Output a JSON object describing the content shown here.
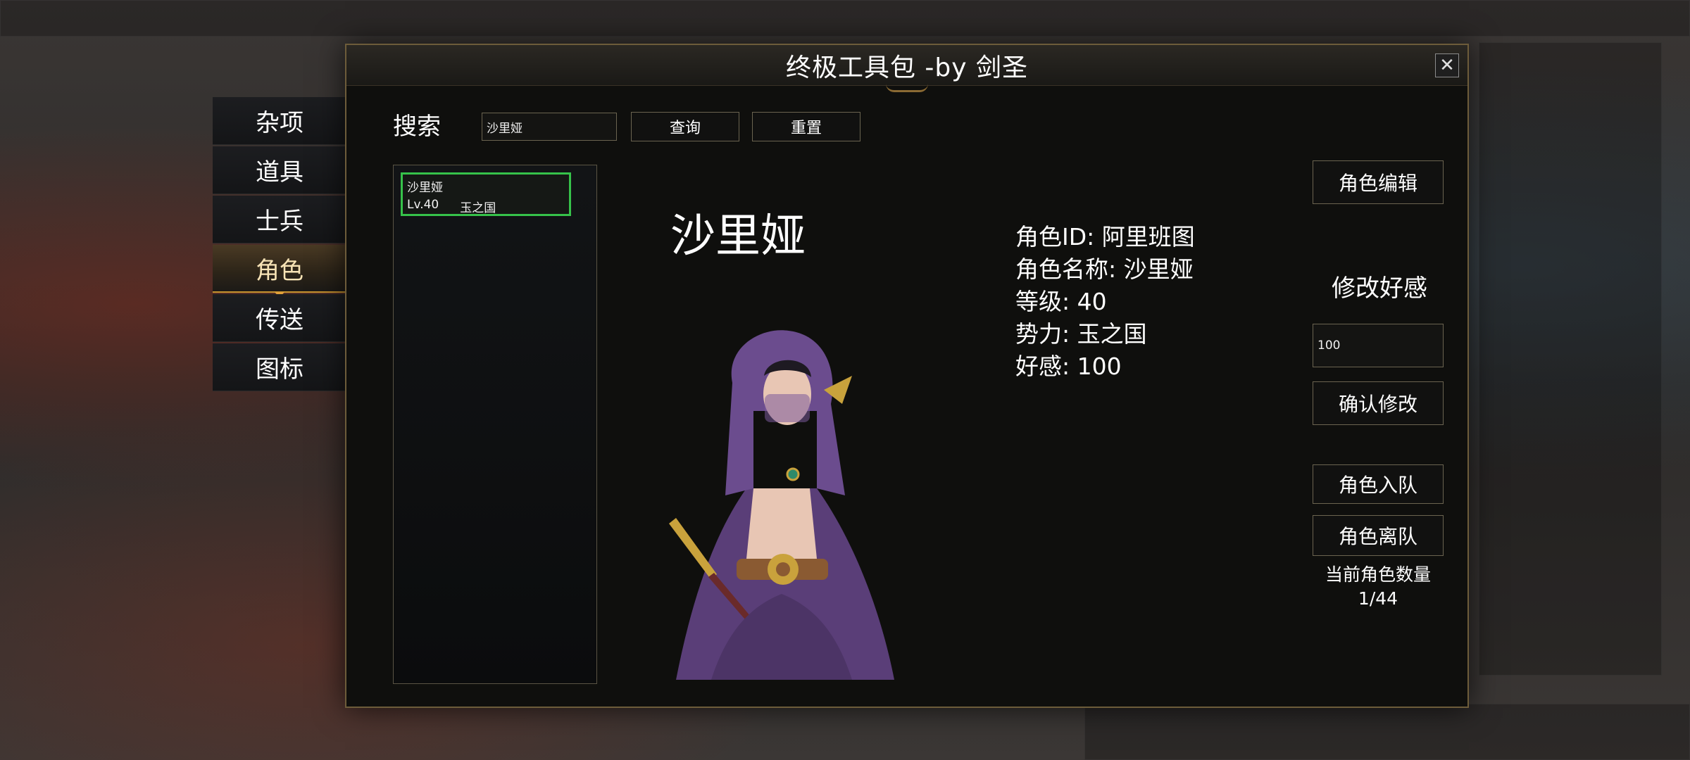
{
  "window": {
    "title": "终极工具包 -by 剑圣",
    "close_label": "✕"
  },
  "nav": {
    "items": [
      {
        "label": "杂项",
        "active": false
      },
      {
        "label": "道具",
        "active": false
      },
      {
        "label": "士兵",
        "active": false
      },
      {
        "label": "角色",
        "active": true
      },
      {
        "label": "传送",
        "active": false
      },
      {
        "label": "图标",
        "active": false
      }
    ]
  },
  "search": {
    "label": "搜索",
    "value": "沙里娅",
    "query_button": "查询",
    "reset_button": "重置"
  },
  "results": [
    {
      "name": "沙里娅",
      "level": "Lv.40",
      "faction": "玉之国",
      "selected": true
    }
  ],
  "character": {
    "name": "沙里娅",
    "info": {
      "id": "角色ID: 阿里班图",
      "name": "角色名称: 沙里娅",
      "level": "等级: 40",
      "faction": "势力: 玉之国",
      "favor": "好感: 100"
    }
  },
  "actions": {
    "edit_button": "角色编辑",
    "favor_heading": "修改好感",
    "favor_value": "100",
    "confirm_button": "确认修改",
    "join_button": "角色入队",
    "leave_button": "角色离队",
    "count_label": "当前角色数量",
    "count_value": "1/44"
  },
  "colors": {
    "accent_gold": "#c8932e",
    "selection_green": "#36c24a",
    "border": "#6b6450",
    "portrait_robe": "#6b4c8e",
    "portrait_gold": "#c9a23c"
  }
}
